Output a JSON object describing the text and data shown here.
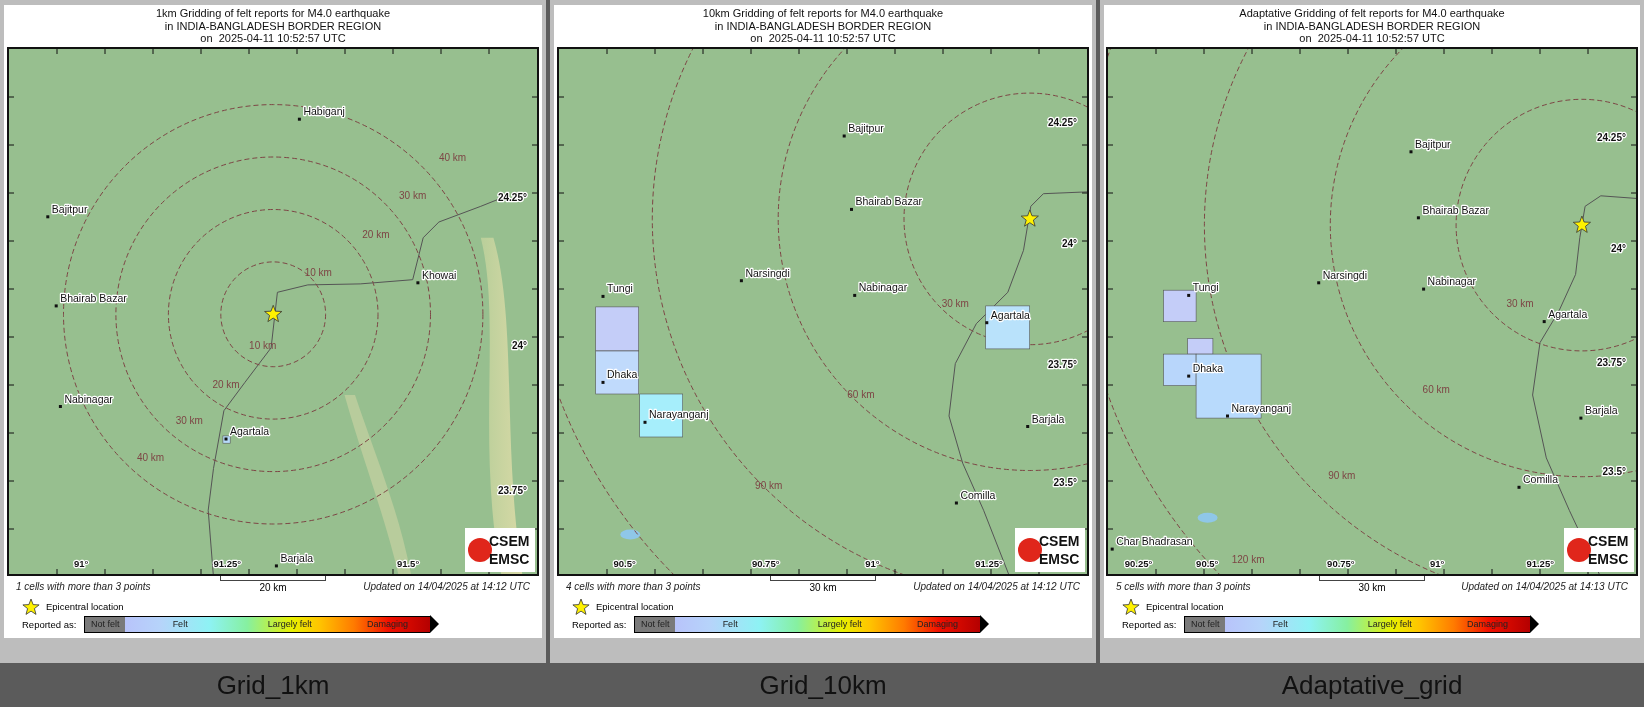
{
  "panels": [
    {
      "title_lines": [
        "1km Gridding of felt reports for M4.0 earthquake",
        "in INDIA-BANGLADESH BORDER REGION",
        "on  2025-04-11 10:52:57 UTC"
      ],
      "map": {
        "places": [
          "Habiganj",
          "Bajitpur",
          "Bhairab Bazar",
          "Nabinagar",
          "Agartala",
          "Khowai",
          "Barjala"
        ],
        "ring_labels": [
          "10 km",
          "20 km",
          "30 km",
          "40 km",
          "10 km",
          "20 km",
          "30 km",
          "40 km"
        ],
        "lat_ticks": [
          "24.25°",
          "24°",
          "23.75°"
        ],
        "lon_ticks": [
          "91°",
          "91.25°",
          "91.5°"
        ],
        "cells": [
          {
            "color": "#b7dcfb"
          }
        ],
        "logo": [
          "CSEM",
          "EMSC"
        ]
      },
      "cells_note": "1 cells with more than 3 points",
      "scale_label": "20 km",
      "updated": "Updated on 14/04/2025 at 14:12 UTC",
      "legend": {
        "epicenter_label": "Epicentral location",
        "reported_as": "Reported as:",
        "levels": [
          "Not felt",
          "Felt",
          "Largely felt",
          "Damaging"
        ]
      },
      "caption": "Grid_1km"
    },
    {
      "title_lines": [
        "10km Gridding of felt reports for M4.0 earthquake",
        "in INDIA-BANGLADESH BORDER REGION",
        "on  2025-04-11 10:52:57 UTC"
      ],
      "map": {
        "places": [
          "Bajitpur",
          "Bhairab Bazar",
          "Narsingdi",
          "Nabinagar",
          "Tungi",
          "Dhaka",
          "Narayanganj",
          "Agartala",
          "Barjala",
          "Comilla"
        ],
        "ring_labels": [
          "30 km",
          "60 km",
          "90 km"
        ],
        "lat_ticks": [
          "24.25°",
          "24°",
          "23.75°",
          "23.5°"
        ],
        "lon_ticks": [
          "90.5°",
          "90.75°",
          "91°",
          "91.25°"
        ],
        "cells": [
          {
            "color": "#c4cdf8"
          },
          {
            "color": "#c0dafc"
          },
          {
            "color": "#a6eefb"
          },
          {
            "color": "#b9e2fb"
          }
        ],
        "logo": [
          "CSEM",
          "EMSC"
        ]
      },
      "cells_note": "4 cells with more than 3 points",
      "scale_label": "30 km",
      "updated": "Updated on 14/04/2025 at 14:12 UTC",
      "legend": {
        "epicenter_label": "Epicentral location",
        "reported_as": "Reported as:",
        "levels": [
          "Not felt",
          "Felt",
          "Largely felt",
          "Damaging"
        ]
      },
      "caption": "Grid_10km"
    },
    {
      "title_lines": [
        "Adaptative Gridding of felt reports for M4.0 earthquake",
        "in INDIA-BANGLADESH BORDER REGION",
        "on  2025-04-11 10:52:57 UTC"
      ],
      "map": {
        "places": [
          "Bajitpur",
          "Bhairab Bazar",
          "Narsingdi",
          "Nabinagar",
          "Tungi",
          "Dhaka",
          "Narayanganj",
          "Agartala",
          "Barjala",
          "Comilla",
          "Char Bhadrasan"
        ],
        "ring_labels": [
          "30 km",
          "60 km",
          "90 km",
          "120 km"
        ],
        "lat_ticks": [
          "24.25°",
          "24°",
          "23.75°",
          "23.5°"
        ],
        "lon_ticks": [
          "90.25°",
          "90.5°",
          "90.75°",
          "91°",
          "91.25°"
        ],
        "cells": [
          {
            "color": "#c4cdf8"
          },
          {
            "color": "#c4cdf8"
          },
          {
            "color": "#b8d6fb"
          },
          {
            "color": "#b8dafc"
          }
        ],
        "logo": [
          "CSEM",
          "EMSC"
        ]
      },
      "cells_note": "5 cells with more than 3 points",
      "scale_label": "30 km",
      "updated": "Updated on 14/04/2025 at 14:13 UTC",
      "legend": {
        "epicenter_label": "Epicentral location",
        "reported_as": "Reported as:",
        "levels": [
          "Not felt",
          "Felt",
          "Largely felt",
          "Damaging"
        ]
      },
      "caption": "Adaptative_grid"
    }
  ]
}
